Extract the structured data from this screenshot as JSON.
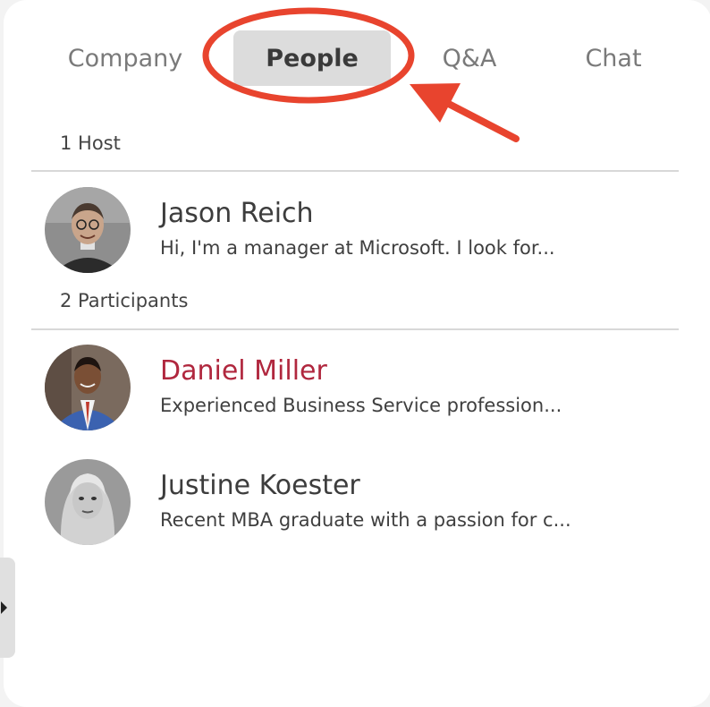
{
  "tabs": [
    {
      "label": "Company",
      "active": false
    },
    {
      "label": "People",
      "active": true
    },
    {
      "label": "Q&A",
      "active": false
    },
    {
      "label": "Chat",
      "active": false
    }
  ],
  "sections": {
    "hosts": {
      "label": "1 Host",
      "people": [
        {
          "name": "Jason Reich",
          "bio": "Hi, I'm a manager at Microsoft. I look for...",
          "highlighted": false
        }
      ]
    },
    "participants": {
      "label": "2 Participants",
      "people": [
        {
          "name": "Daniel Miller",
          "bio": "Experienced Business Service profession...",
          "highlighted": true
        },
        {
          "name": "Justine Koester",
          "bio": "Recent MBA graduate with a passion for c...",
          "highlighted": false
        }
      ]
    }
  },
  "annotation": {
    "color": "#e8442e",
    "shape": "ellipse-with-arrow",
    "target": "People tab"
  },
  "colors": {
    "accent_name": "#b0273e",
    "active_tab_bg": "#dcdcdc",
    "inactive_tab_text": "#7a7a7a"
  },
  "icons": {
    "side_toggle": "chevron-right-icon"
  }
}
